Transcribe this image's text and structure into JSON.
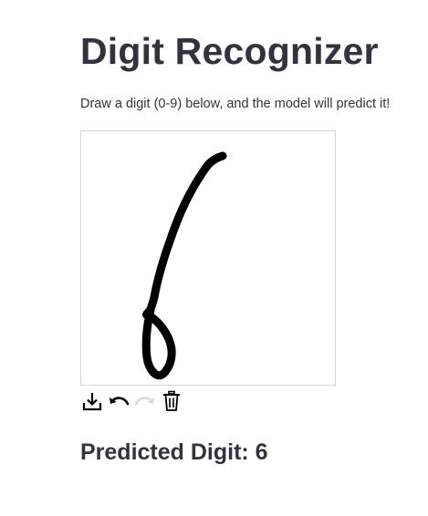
{
  "header": {
    "title": "Digit Recognizer",
    "subtitle": "Draw a digit (0-9) below, and the model will predict it!"
  },
  "toolbar": {
    "icons": [
      "download-icon",
      "undo-icon",
      "redo-icon",
      "trash-icon"
    ],
    "redo_enabled": false
  },
  "result": {
    "prediction_text": "Predicted Digit: 6"
  },
  "colors": {
    "text": "#31333f",
    "stroke": "#000000",
    "canvas_border": "#d3d3d3",
    "disabled_icon": "#d5dbe3"
  }
}
